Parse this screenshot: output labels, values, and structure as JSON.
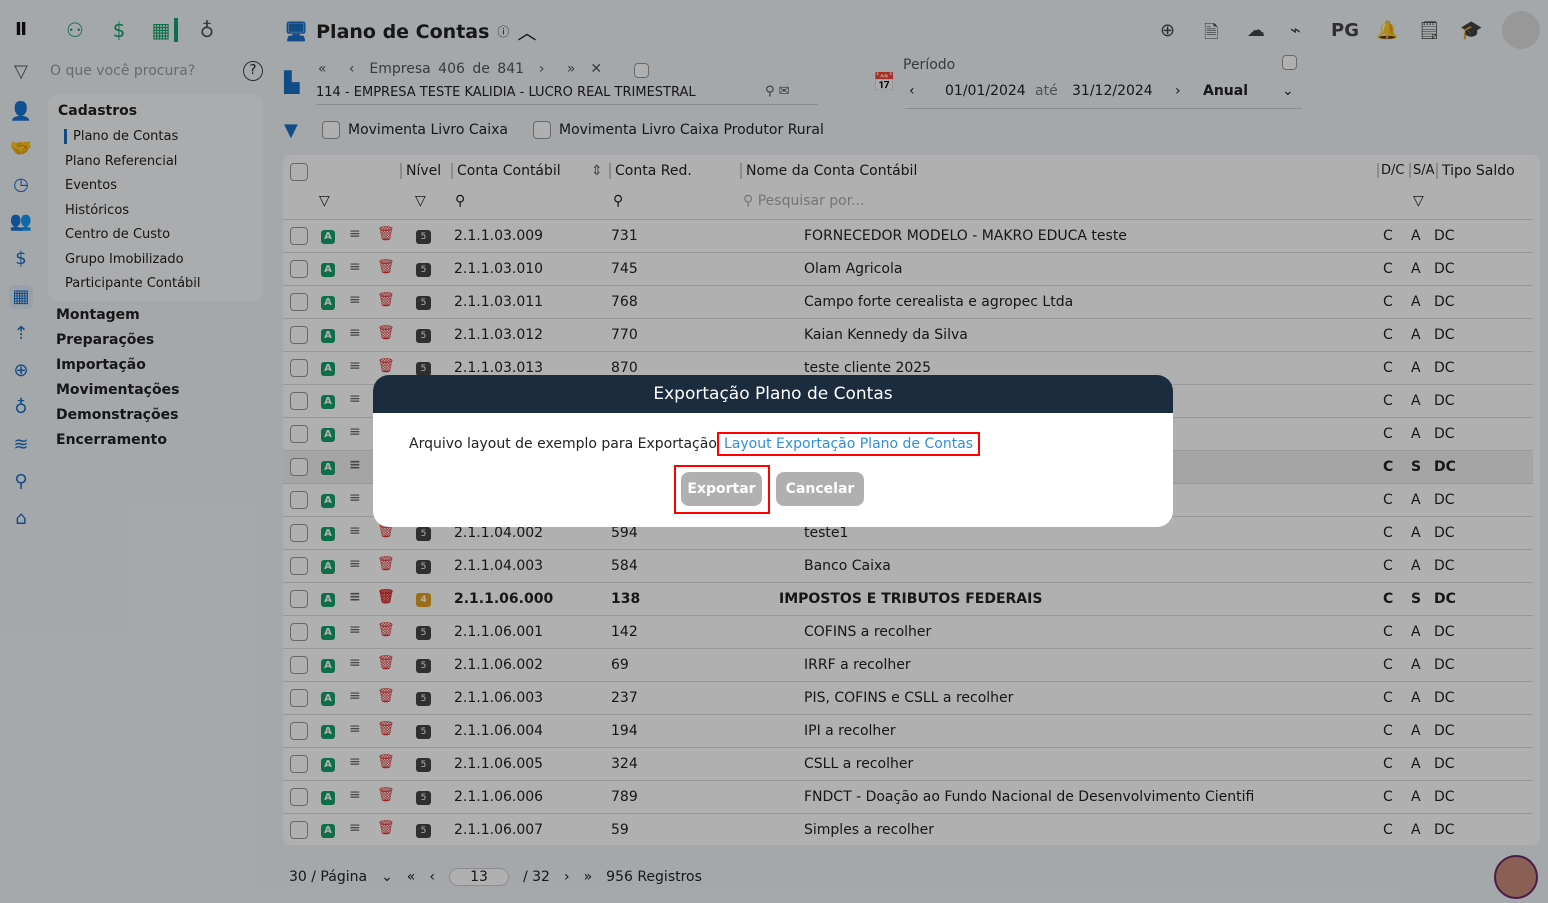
{
  "header": {
    "title": "Plano de Contas",
    "icons": [
      "plus-circle-icon",
      "document-icon",
      "cloud-upload-icon",
      "broom-icon",
      "notification-bell-icon",
      "report-search-icon",
      "graduation-cap-icon"
    ],
    "pg_label": "PG"
  },
  "search": {
    "placeholder": "O que você procura?"
  },
  "company": {
    "nav": "Empresa 406 de 841",
    "name": "114 - EMPRESA TESTE KALIDIA - LUCRO REAL TRIMESTRAL"
  },
  "period": {
    "label": "Período",
    "from": "01/01/2024",
    "to_label": "até",
    "to": "31/12/2024",
    "type": "Anual"
  },
  "filters": [
    "Movimenta Livro Caixa",
    "Movimenta Livro Caixa Produtor Rural"
  ],
  "sidebar": {
    "section": "Cadastros",
    "items": [
      "Plano de Contas",
      "Plano Referencial",
      "Eventos",
      "Históricos",
      "Centro de Custo",
      "Grupo Imobilizado",
      "Participante Contábil"
    ],
    "groups": [
      "Montagem",
      "Preparações",
      "Importação",
      "Movimentações",
      "Demonstrações",
      "Encerramento"
    ]
  },
  "table": {
    "columns": {
      "nivel": "Nível",
      "conta": "Conta Contábil",
      "red": "Conta Red.",
      "nome": "Nome da Conta Contábil",
      "dc": "D/C",
      "sa": "S/A",
      "tipo": "Tipo Saldo"
    },
    "search_placeholder": "Pesquisar por...",
    "rows": [
      {
        "lvl": "5",
        "conta": "2.1.1.03.009",
        "red": "731",
        "nome": "FORNECEDOR MODELO - MAKRO EDUCA teste",
        "dc": "C",
        "sa": "A",
        "tipo": "DC"
      },
      {
        "lvl": "5",
        "conta": "2.1.1.03.010",
        "red": "745",
        "nome": "Olam Agricola",
        "dc": "C",
        "sa": "A",
        "tipo": "DC"
      },
      {
        "lvl": "5",
        "conta": "2.1.1.03.011",
        "red": "768",
        "nome": "Campo forte cerealista e agropec Ltda",
        "dc": "C",
        "sa": "A",
        "tipo": "DC"
      },
      {
        "lvl": "5",
        "conta": "2.1.1.03.012",
        "red": "770",
        "nome": "Kaian Kennedy da Silva",
        "dc": "C",
        "sa": "A",
        "tipo": "DC"
      },
      {
        "lvl": "5",
        "conta": "2.1.1.03.013",
        "red": "870",
        "nome": "teste cliente 2025",
        "dc": "C",
        "sa": "A",
        "tipo": "DC"
      },
      {
        "lvl": "",
        "conta": "",
        "red": "",
        "nome": "",
        "dc": "C",
        "sa": "A",
        "tipo": "DC"
      },
      {
        "lvl": "",
        "conta": "",
        "red": "",
        "nome": "",
        "dc": "C",
        "sa": "A",
        "tipo": "DC"
      },
      {
        "lvl": "",
        "conta": "",
        "red": "",
        "nome": "",
        "dc": "C",
        "sa": "S",
        "tipo": "DC",
        "bold": true
      },
      {
        "lvl": "",
        "conta": "",
        "red": "",
        "nome": "",
        "dc": "C",
        "sa": "A",
        "tipo": "DC"
      },
      {
        "lvl": "5",
        "conta": "2.1.1.04.002",
        "red": "594",
        "nome": "teste1",
        "dc": "C",
        "sa": "A",
        "tipo": "DC"
      },
      {
        "lvl": "5",
        "conta": "2.1.1.04.003",
        "red": "584",
        "nome": "Banco Caixa",
        "dc": "C",
        "sa": "A",
        "tipo": "DC"
      },
      {
        "lvl": "4",
        "conta": "2.1.1.06.000",
        "red": "138",
        "nome": "IMPOSTOS E TRIBUTOS FEDERAIS",
        "dc": "C",
        "sa": "S",
        "tipo": "DC",
        "bold": true
      },
      {
        "lvl": "5",
        "conta": "2.1.1.06.001",
        "red": "142",
        "nome": "COFINS a recolher",
        "dc": "C",
        "sa": "A",
        "tipo": "DC"
      },
      {
        "lvl": "5",
        "conta": "2.1.1.06.002",
        "red": "69",
        "nome": "IRRF a recolher",
        "dc": "C",
        "sa": "A",
        "tipo": "DC"
      },
      {
        "lvl": "5",
        "conta": "2.1.1.06.003",
        "red": "237",
        "nome": "PIS, COFINS e CSLL a recolher",
        "dc": "C",
        "sa": "A",
        "tipo": "DC"
      },
      {
        "lvl": "5",
        "conta": "2.1.1.06.004",
        "red": "194",
        "nome": "IPI a recolher",
        "dc": "C",
        "sa": "A",
        "tipo": "DC"
      },
      {
        "lvl": "5",
        "conta": "2.1.1.06.005",
        "red": "324",
        "nome": "CSLL a recolher",
        "dc": "C",
        "sa": "A",
        "tipo": "DC"
      },
      {
        "lvl": "5",
        "conta": "2.1.1.06.006",
        "red": "789",
        "nome": "FNDCT - Doação ao Fundo Nacional de Desenvolvimento Cientifi",
        "dc": "C",
        "sa": "A",
        "tipo": "DC"
      },
      {
        "lvl": "5",
        "conta": "2.1.1.06.007",
        "red": "59",
        "nome": "Simples a recolher",
        "dc": "C",
        "sa": "A",
        "tipo": "DC"
      }
    ]
  },
  "pagination": {
    "per_page": "30 / Página",
    "page": "13",
    "total_pages": "/ 32",
    "records": "956 Registros"
  },
  "modal": {
    "title": "Exportação Plano de Contas",
    "text": "Arquivo layout de exemplo para Exportação",
    "link": "Layout Exportação Plano de Contas",
    "export": "Exportar",
    "cancel": "Cancelar"
  }
}
